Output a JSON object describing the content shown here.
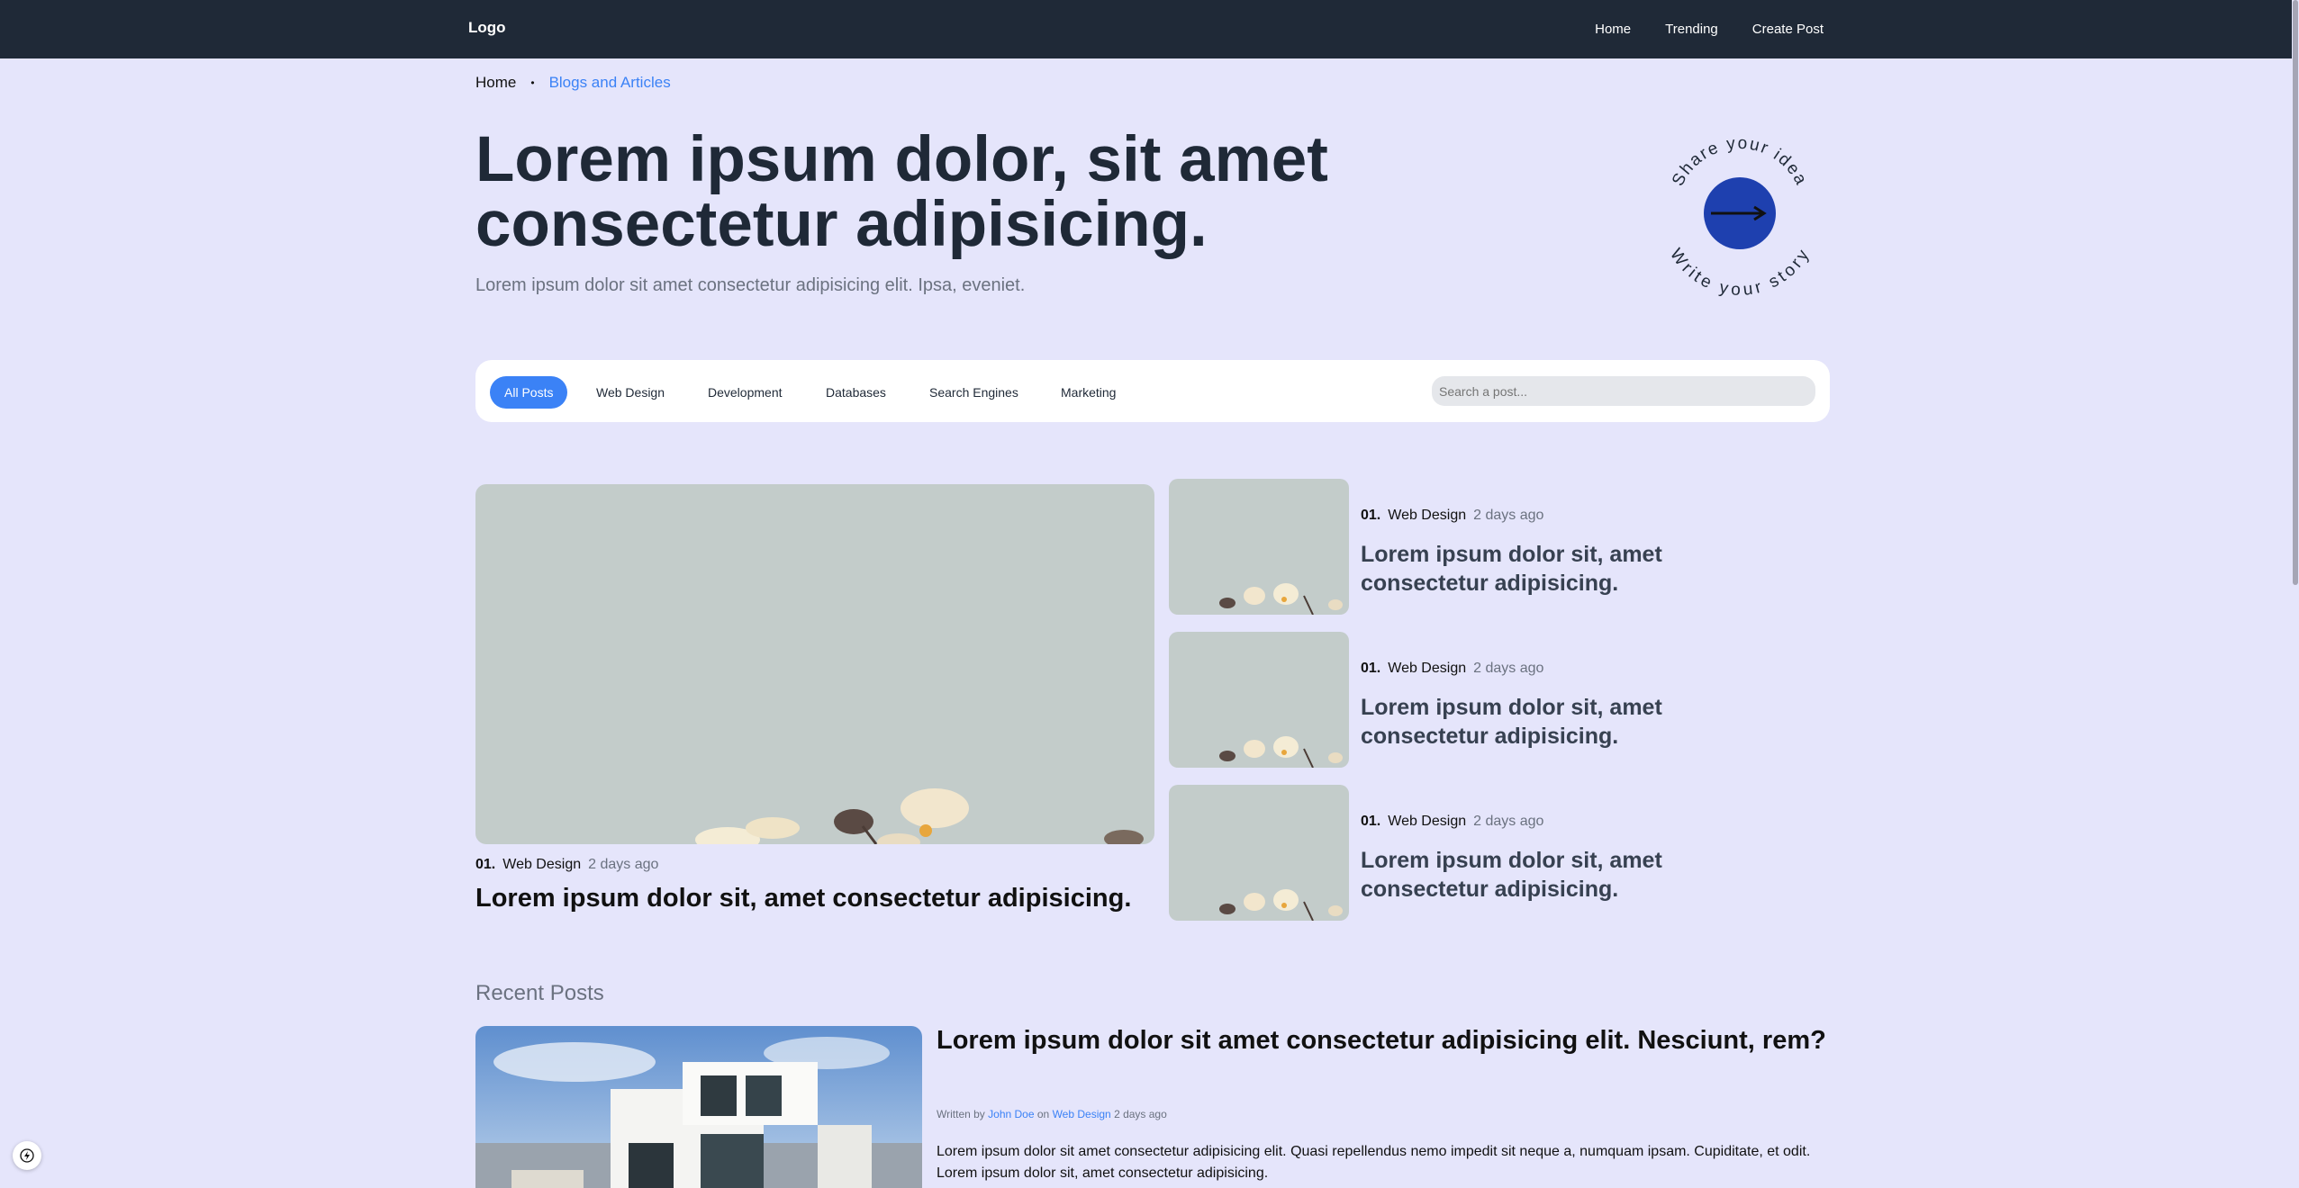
{
  "nav": {
    "logo": "Logo",
    "links": [
      "Home",
      "Trending",
      "Create Post"
    ]
  },
  "breadcrumb": {
    "home": "Home",
    "separator": "•",
    "current": "Blogs and Articles"
  },
  "hero": {
    "title": "Lorem ipsum dolor, sit amet consectetur adipisicing.",
    "subtitle": "Lorem ipsum dolor sit amet consectetur adipisicing elit. Ipsa, eveniet.",
    "badge_top_text": "Share your idea",
    "badge_bottom_text": "Write your story",
    "badge_icon": "arrow-right-icon"
  },
  "filters": {
    "tabs": [
      "All Posts",
      "Web Design",
      "Development",
      "Databases",
      "Search Engines",
      "Marketing"
    ],
    "active": "All Posts",
    "search_placeholder": "Search a post..."
  },
  "featured": {
    "number": "01.",
    "category": "Web Design",
    "date": "2 days ago",
    "title": "Lorem ipsum dolor sit, amet consectetur adipisicing."
  },
  "side_posts": [
    {
      "number": "01.",
      "category": "Web Design",
      "date": "2 days ago",
      "title": "Lorem ipsum dolor sit, amet consectetur adipisicing."
    },
    {
      "number": "01.",
      "category": "Web Design",
      "date": "2 days ago",
      "title": "Lorem ipsum dolor sit, amet consectetur adipisicing."
    },
    {
      "number": "01.",
      "category": "Web Design",
      "date": "2 days ago",
      "title": "Lorem ipsum dolor sit, amet consectetur adipisicing."
    }
  ],
  "recent": {
    "heading": "Recent Posts",
    "title": "Lorem ipsum dolor sit amet consectetur adipisicing elit. Nesciunt, rem?",
    "written_by": "Written by",
    "author": "John Doe",
    "on": "on",
    "category": "Web Design",
    "date": "2 days ago",
    "excerpt": "Lorem ipsum dolor sit amet consectetur adipisicing elit. Quasi repellendus nemo impedit sit neque a, numquam ipsam. Cupiditate, et odit. Lorem ipsum dolor sit, amet consectetur adipisicing."
  },
  "colors": {
    "background": "#e5e5fb",
    "navbar": "#1f2937",
    "accent": "#3b82f6",
    "badge_circle": "#1e40af"
  },
  "corner_icon": "lightning-icon"
}
